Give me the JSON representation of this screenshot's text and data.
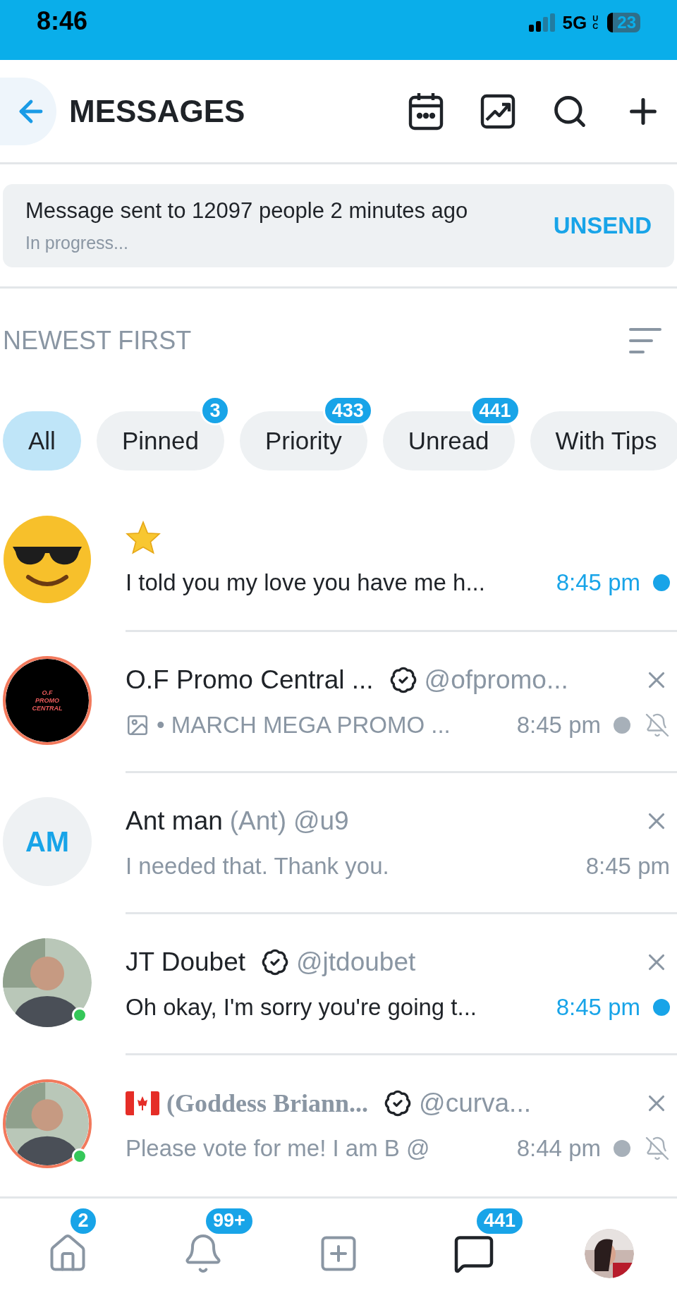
{
  "status_bar": {
    "time": "8:46",
    "network": "5G",
    "network_suffix": "UC",
    "battery": "23"
  },
  "header": {
    "title": "MESSAGES"
  },
  "banner": {
    "text": "Message sent to 12097 people 2 minutes ago",
    "status": "In progress...",
    "action": "UNSEND"
  },
  "sort": {
    "label": "NEWEST FIRST"
  },
  "filters": [
    {
      "label": "All",
      "selected": true
    },
    {
      "label": "Pinned",
      "selected": false,
      "count": "3"
    },
    {
      "label": "Priority",
      "selected": false,
      "count": "433"
    },
    {
      "label": "Unread",
      "selected": false,
      "count": "441"
    },
    {
      "label": "With Tips",
      "selected": false
    }
  ],
  "conversations": [
    {
      "avatar": {
        "kind": "emoji"
      },
      "starred": true,
      "preview": "I told you my love you have me h...",
      "time": "8:45 pm",
      "unread": true,
      "closable": false,
      "muted": false,
      "online": false,
      "story": false
    },
    {
      "avatar": {
        "kind": "logo",
        "text": "O.F PROMO CENTRAL"
      },
      "starred": false,
      "name": "O.F Promo Central ...",
      "verified": true,
      "handle": "@ofpromo...",
      "preview_image": true,
      "preview": "• MARCH MEGA PROMO ...",
      "time": "8:45 pm",
      "unread": true,
      "closable": true,
      "muted": true,
      "online": false,
      "story": true
    },
    {
      "avatar": {
        "kind": "initials",
        "text": "AM"
      },
      "starred": false,
      "name": "Ant man",
      "nickname": "(Ant)",
      "handle": "@u9",
      "preview": "I needed that. Thank you.",
      "time": "8:45 pm",
      "unread": false,
      "closable": true,
      "muted": false,
      "online": false,
      "story": false
    },
    {
      "starred": false,
      "name": "JT Doubet",
      "verified": true,
      "handle": "@jtdoubet",
      "preview": "Oh okay, I'm sorry you're going t...",
      "time": "8:45 pm",
      "unread": true,
      "closable": true,
      "muted": false,
      "online": true,
      "story": false
    },
    {
      "starred": false,
      "flag": true,
      "nickname_serif": "(Goddess Briann...",
      "verified": true,
      "handle": "@curva...",
      "preview": "Please vote for me! I am B @",
      "time": "8:44 pm",
      "unread": true,
      "closable": true,
      "muted": true,
      "online": true,
      "story": true
    }
  ],
  "bottom_nav": [
    {
      "kind": "home",
      "count": "2"
    },
    {
      "kind": "bell",
      "count": "99+"
    },
    {
      "kind": "add"
    },
    {
      "kind": "messages",
      "count": "441",
      "selected": true
    },
    {
      "kind": "profile"
    }
  ]
}
